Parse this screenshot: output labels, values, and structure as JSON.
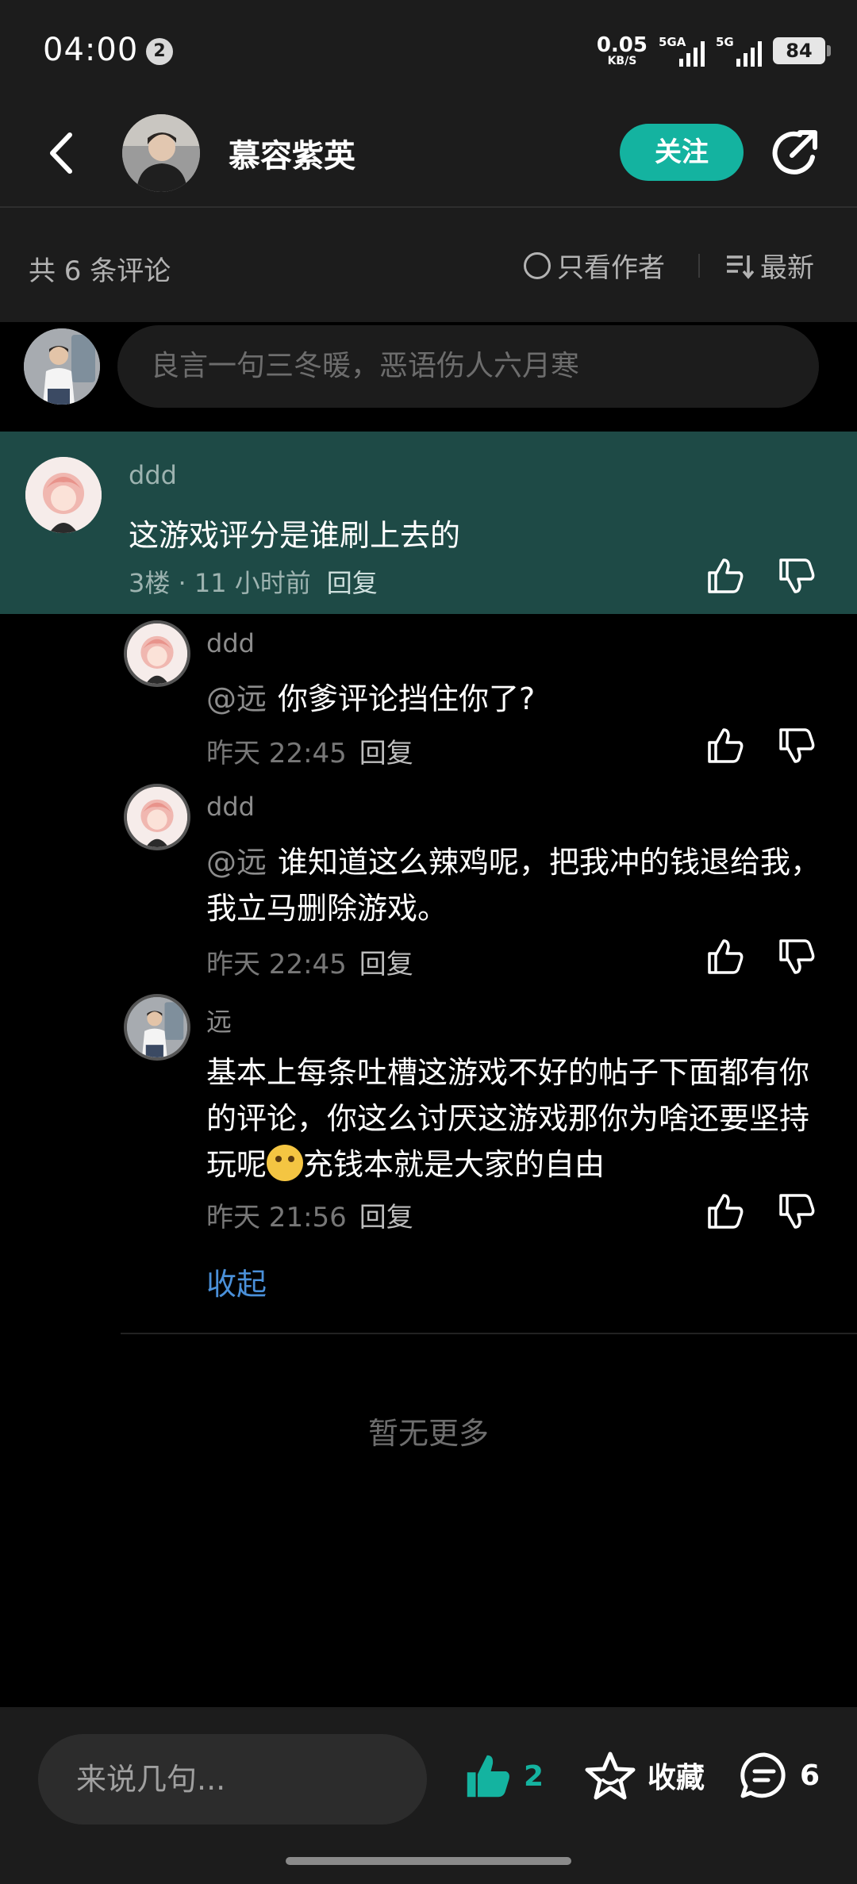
{
  "status_bar": {
    "time": "04:00",
    "notification_count": "2",
    "net_speed_value": "0.05",
    "net_speed_unit": "KB/S",
    "signal1_label": "5GA",
    "signal2_label": "5G",
    "battery": "84"
  },
  "header": {
    "author_name": "慕容紫英",
    "follow_label": "关注"
  },
  "sort_bar": {
    "count_label": "共 6 条评论",
    "author_only_label": "只看作者",
    "sort_label": "最新"
  },
  "comment_input": {
    "placeholder": "良言一句三冬暖，恶语伤人六月寒"
  },
  "main_comment": {
    "username": "ddd",
    "text": "这游戏评分是谁刷上去的",
    "floor_time": "3楼 · 11 小时前",
    "reply_label": "回复"
  },
  "replies": [
    {
      "username": "ddd",
      "mention": "@远",
      "text": "你爹评论挡住你了?",
      "time": "昨天 22:45",
      "reply_label": "回复"
    },
    {
      "username": "ddd",
      "mention": "@远",
      "text": "谁知道这么辣鸡呢，把我冲的钱退给我，我立马删除游戏。",
      "time": "昨天 22:45",
      "reply_label": "回复"
    },
    {
      "username": "远",
      "text_before_emoji": "基本上每条吐槽这游戏不好的帖子下面都有你的评论，你这么讨厌这游戏那你为啥还要坚持玩呢",
      "text_after_emoji": "充钱本就是大家的自由",
      "time": "昨天 21:56",
      "reply_label": "回复"
    }
  ],
  "collapse_label": "收起",
  "no_more_label": "暂无更多",
  "bottom_bar": {
    "input_placeholder": "来说几句...",
    "like_count": "2",
    "favorite_label": "收藏",
    "comment_count": "6"
  },
  "colors": {
    "accent": "#14b3a0",
    "highlight_bg": "#1e4a46",
    "link": "#4a90d9"
  }
}
